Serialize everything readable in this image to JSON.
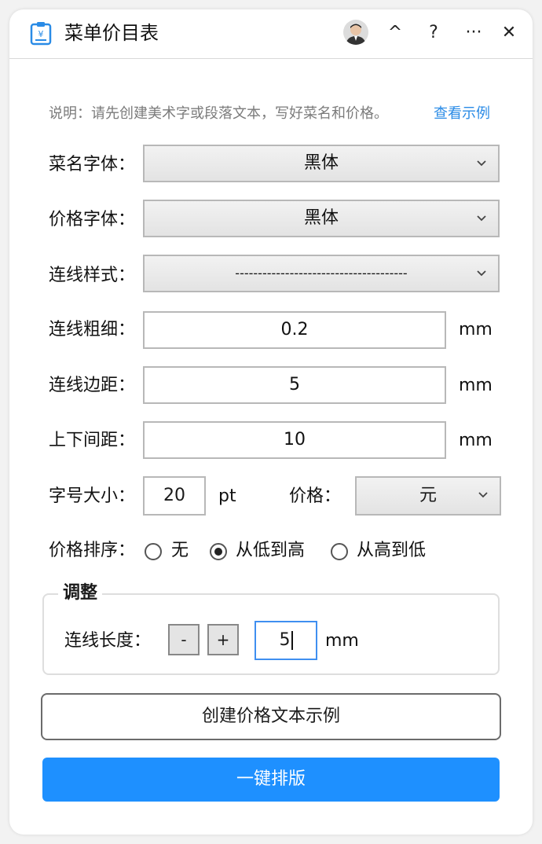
{
  "app": {
    "title": "菜单价目表"
  },
  "header": {
    "collapse_glyph": "^",
    "help_glyph": "?",
    "more_glyph": "···",
    "close_glyph": "✕"
  },
  "instructions": {
    "text": "说明：请先创建美术字或段落文本，写好菜名和价格。",
    "link": "查看示例"
  },
  "fields": {
    "dish_font": {
      "label": "菜名字体：",
      "value": "黑体"
    },
    "price_font": {
      "label": "价格字体：",
      "value": "黑体"
    },
    "line_style": {
      "label": "连线样式：",
      "value": "--------------------------------------"
    },
    "line_width": {
      "label": "连线粗细：",
      "value": "0.2",
      "unit": "mm"
    },
    "line_margin": {
      "label": "连线边距：",
      "value": "5",
      "unit": "mm"
    },
    "vertical_spacing": {
      "label": "上下间距：",
      "value": "10",
      "unit": "mm"
    },
    "font_size": {
      "label": "字号大小：",
      "value": "20",
      "unit": "pt"
    },
    "price_unit": {
      "label": "价格：",
      "value": "元"
    }
  },
  "sort": {
    "label": "价格排序：",
    "options": [
      {
        "label": "无",
        "checked": false
      },
      {
        "label": "从低到高",
        "checked": true
      },
      {
        "label": "从高到低",
        "checked": false
      }
    ]
  },
  "adjust": {
    "title": "调整",
    "length_label": "连线长度：",
    "minus": "-",
    "plus": "+",
    "value": "5",
    "unit": "mm"
  },
  "buttons": {
    "create_example": "创建价格文本示例",
    "one_click_layout": "一键排版"
  },
  "colors": {
    "primary": "#1e90ff",
    "link": "#2a8be6",
    "focus_border": "#3f8ff0"
  },
  "icons": {
    "app": "menu-price-icon",
    "dropdown": "chevron-down-icon"
  }
}
